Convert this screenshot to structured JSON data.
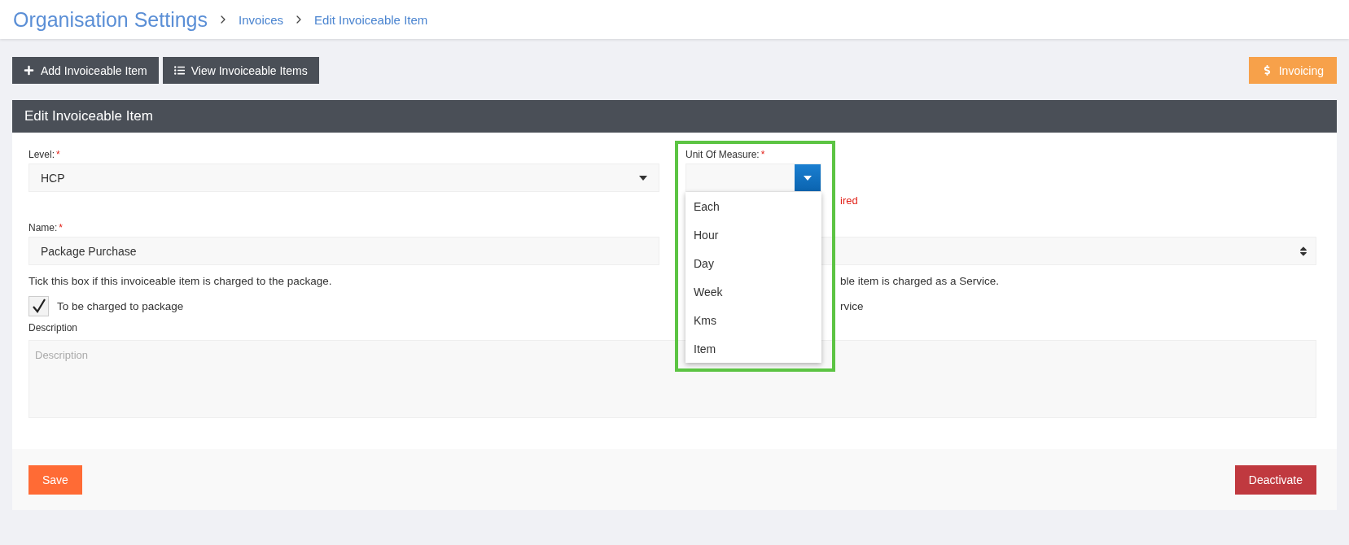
{
  "header": {
    "title": "Organisation Settings",
    "breadcrumbs": [
      {
        "label": "Invoices"
      },
      {
        "label": "Edit Invoiceable Item"
      }
    ]
  },
  "toolbar": {
    "buttons": [
      {
        "label": "Add Invoiceable Item"
      },
      {
        "label": "View Invoiceable Items"
      }
    ],
    "invoicing": {
      "label": "Invoicing"
    }
  },
  "panel": {
    "title": "Edit Invoiceable Item"
  },
  "level": {
    "label": "Level:",
    "required_mark": "*",
    "value": "HCP"
  },
  "name": {
    "label": "Name:",
    "required_mark": "*",
    "value": "Package Purchase"
  },
  "package": {
    "hint": "Tick this box if this invoiceable item is charged to the package.",
    "label": "To be charged to package",
    "checked": true
  },
  "unit_of_measure": {
    "label": "Unit Of Measure:",
    "required_mark": "*",
    "expanded": true,
    "highlighted": true,
    "error_fragment": "ired",
    "options": [
      {
        "label": "Each"
      },
      {
        "label": "Hour"
      },
      {
        "label": "Day"
      },
      {
        "label": "Week"
      },
      {
        "label": "Kms"
      },
      {
        "label": "Item"
      }
    ]
  },
  "service": {
    "hint_fragment": "ble item is charged as a Service.",
    "label_fragment": "rvice"
  },
  "description": {
    "label": "Description",
    "placeholder": "Description"
  },
  "footer": {
    "save": "Save",
    "deactivate": "Deactivate"
  }
}
